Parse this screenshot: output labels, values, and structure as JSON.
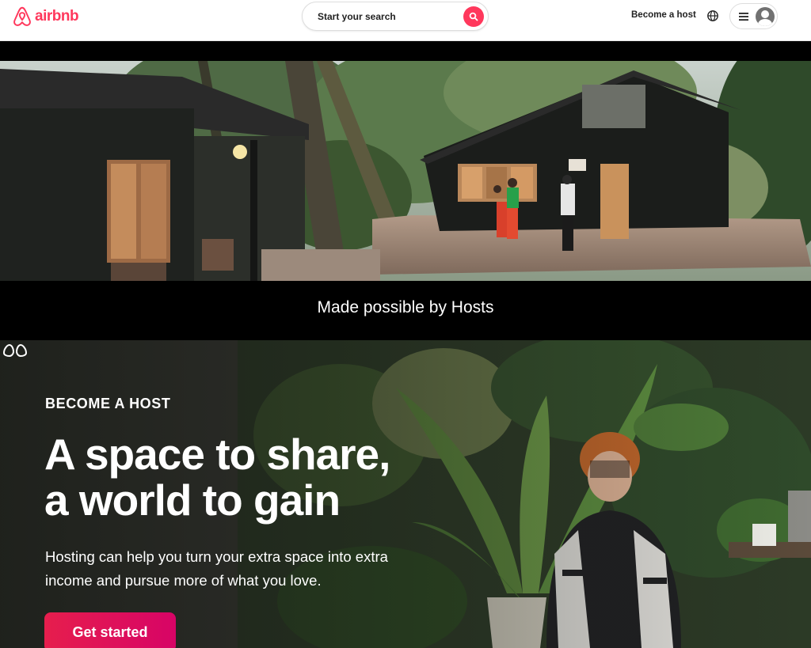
{
  "header": {
    "brand": "airbnb",
    "search_label": "Start your search",
    "become_host": "Become a host",
    "icons": {
      "logo": "airbnb-belo-icon",
      "search": "search-icon",
      "globe": "globe-icon",
      "menu": "hamburger-menu-icon",
      "avatar": "user-avatar-icon"
    }
  },
  "hero": {
    "caption": "Made possible by Hosts"
  },
  "host_section": {
    "eyebrow": "BECOME A HOST",
    "title_line1": "A space to share,",
    "title_line2": "a world to gain",
    "body": "Hosting can help you turn your extra space into extra income and pursue more of what you love.",
    "cta": "Get started"
  },
  "colors": {
    "brand": "#ff385c",
    "cta_start": "#e61e4d",
    "cta_end": "#d70466"
  }
}
